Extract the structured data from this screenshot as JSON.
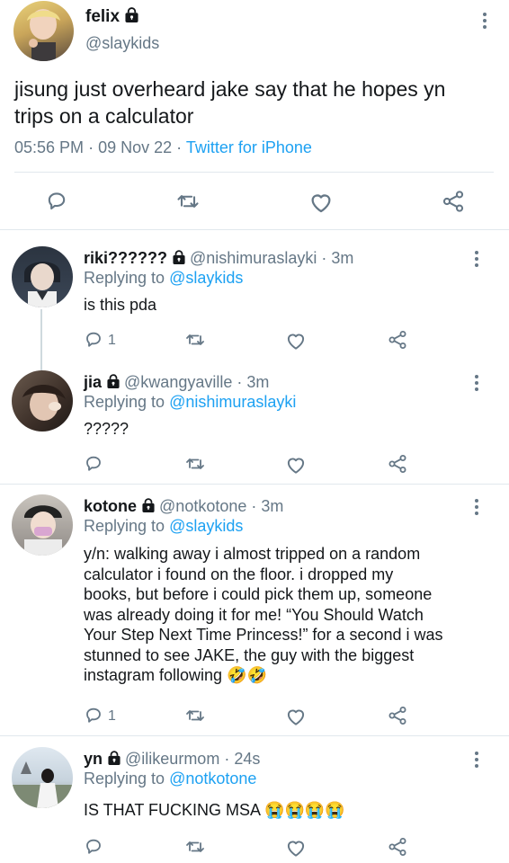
{
  "main_tweet": {
    "display_name": "felix",
    "handle": "@slaykids",
    "text_line1": "jisung just overheard jake say that he hopes yn",
    "text_line2": "trips on a calculator",
    "time": "05:56 PM",
    "sep": "·",
    "date": "09 Nov 22",
    "source": "Twitter for iPhone"
  },
  "icons": {
    "reply": "speech-bubble",
    "retweet": "retweet-arrows",
    "like": "heart",
    "share": "share-nodes",
    "more": "vertical-ellipsis",
    "lock": "padlock"
  },
  "colors": {
    "link": "#1da1f2",
    "muted": "#657786",
    "divider": "#e1e8ed",
    "thread_line": "#cfd9de"
  },
  "replies": [
    {
      "display_name": "riki??????",
      "handle": "@nishimuraslayki",
      "sep": "·",
      "time": "3m",
      "replying_prefix": "Replying to",
      "replying_to": "@slaykids",
      "text": "is this pda",
      "reply_count": "1"
    },
    {
      "display_name": "jia",
      "handle": "@kwangyaville",
      "sep": "·",
      "time": "3m",
      "replying_prefix": "Replying to",
      "replying_to": "@nishimuraslayki",
      "text": "?????"
    },
    {
      "display_name": "kotone",
      "handle": "@notkotone",
      "sep": "·",
      "time": "3m",
      "replying_prefix": "Replying to",
      "replying_to": "@slaykids",
      "lines": [
        "y/n: walking away i almost tripped on a random",
        "calculator i found on the floor. i dropped my",
        "books, but before i could pick them up, someone",
        "was already doing it for me! “You Should Watch",
        "Your Step Next Time Princess!” for a second i was",
        "stunned to see JAKE, the guy with the biggest",
        "instagram following 🤣🤣"
      ],
      "reply_count": "1"
    },
    {
      "display_name": "yn",
      "handle": "@ilikeurmom",
      "sep": "·",
      "time": "24s",
      "replying_prefix": "Replying to",
      "replying_to": "@notkotone",
      "text": "IS THAT FUCKING MSA 😭😭😭😭"
    }
  ]
}
